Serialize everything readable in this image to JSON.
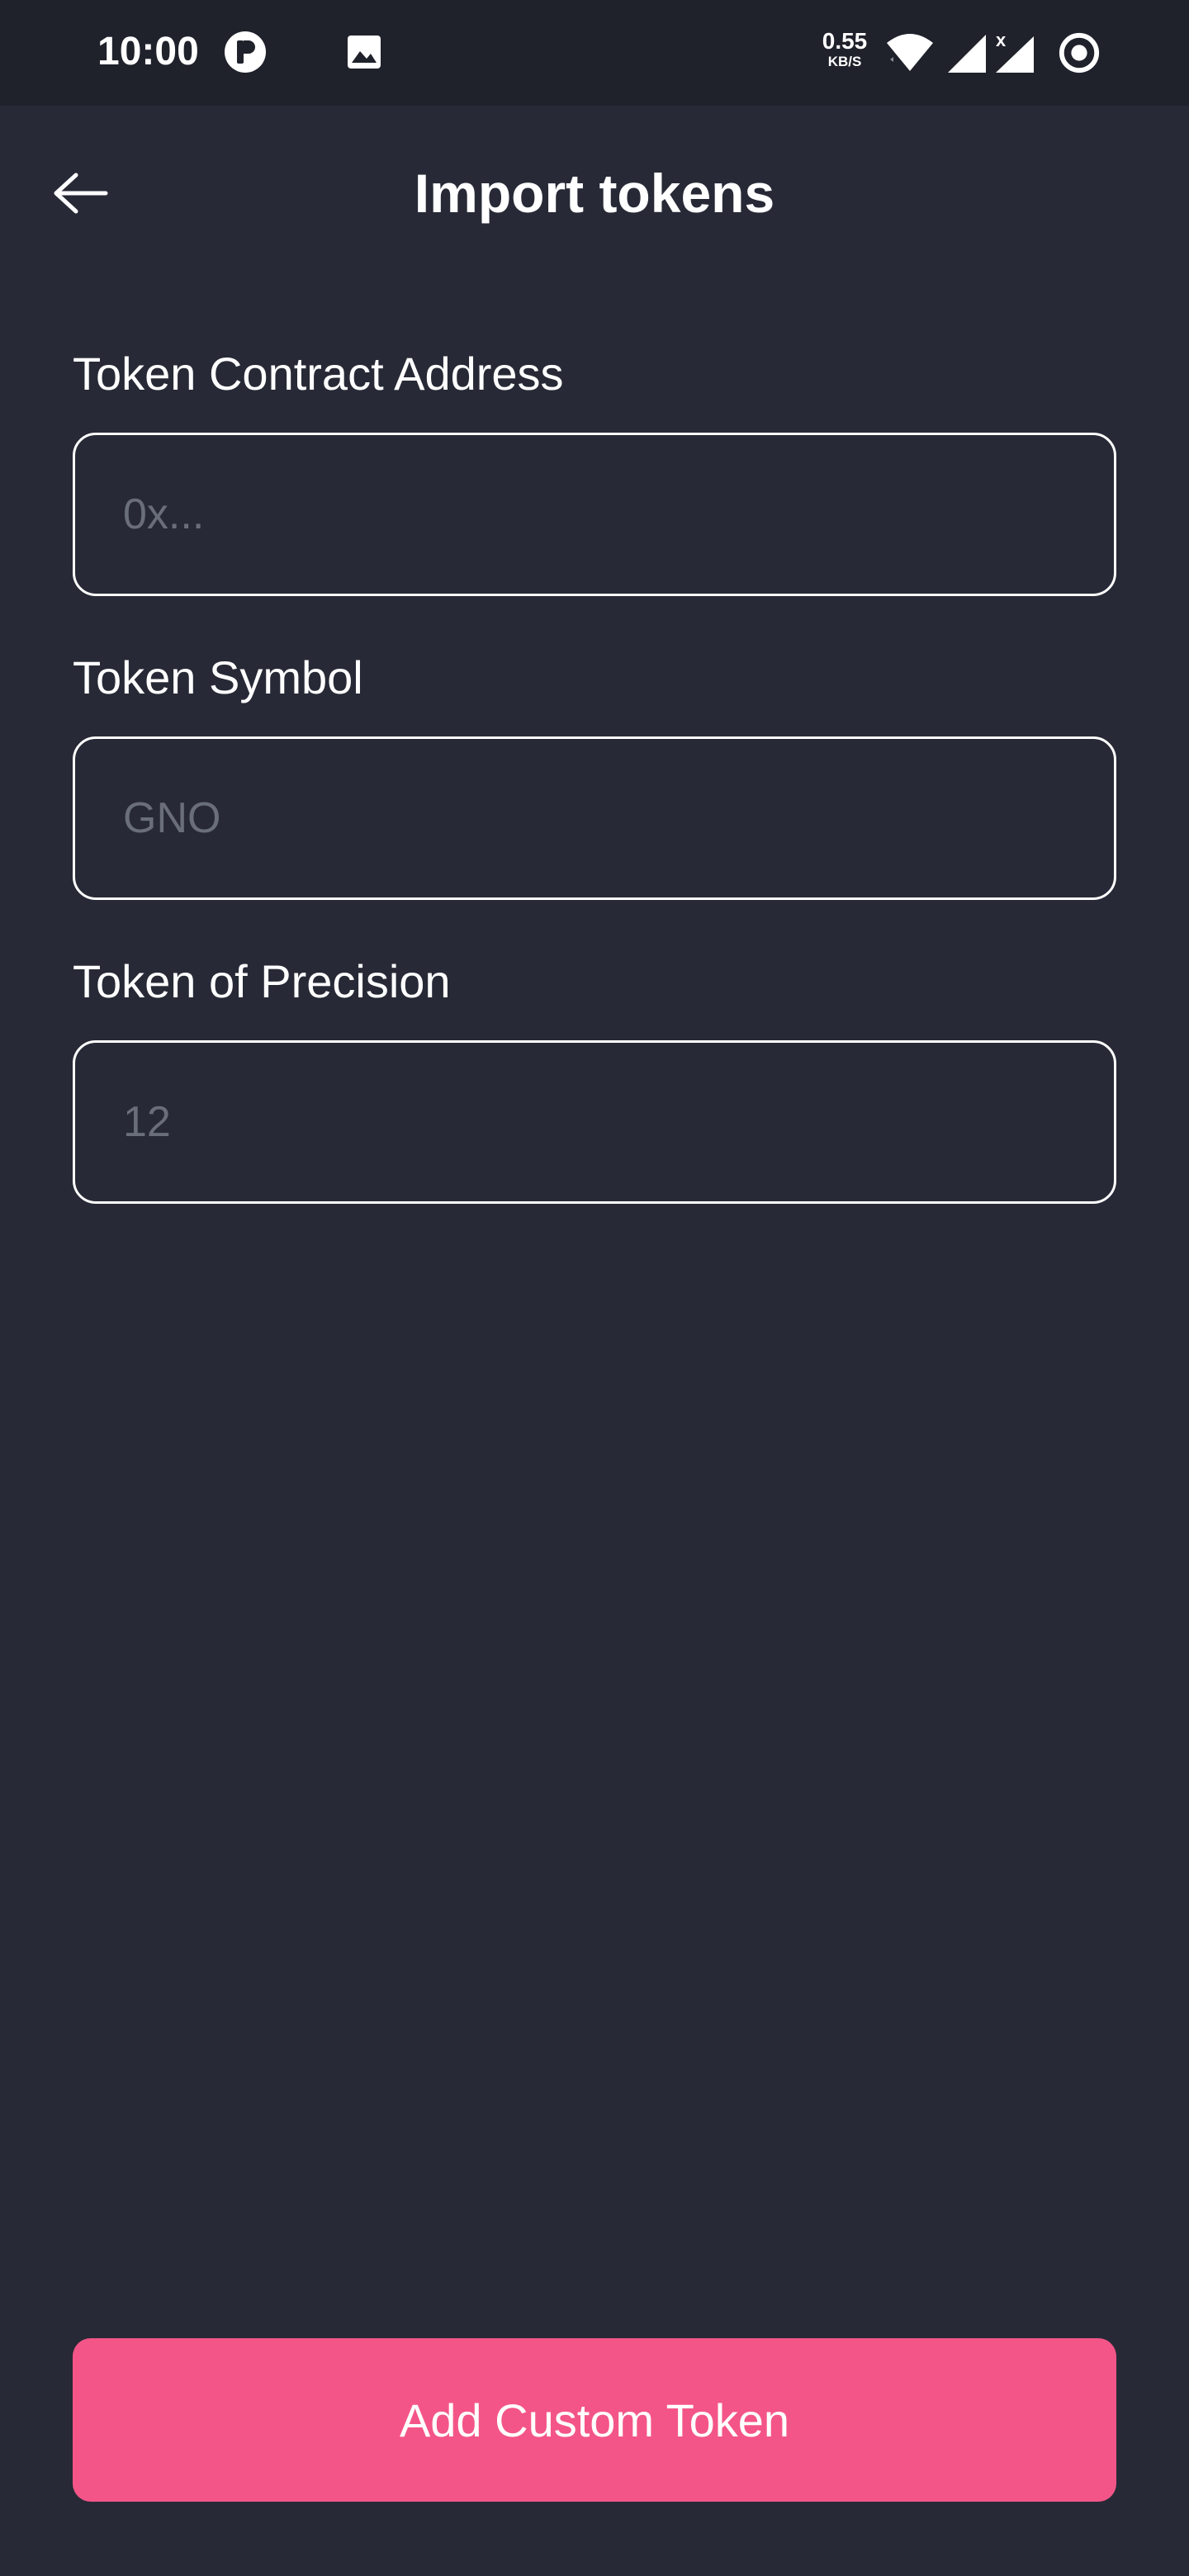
{
  "status_bar": {
    "time": "10:00",
    "network_speed_value": "0.55",
    "network_speed_unit": "KB/S",
    "icons": [
      "app-notification-icon",
      "image-notification-icon",
      "wifi-icon",
      "signal-icon",
      "signal-no-service-icon",
      "record-icon"
    ]
  },
  "header": {
    "title": "Import tokens",
    "back_icon": "arrow-left-icon"
  },
  "form": {
    "fields": [
      {
        "label": "Token Contract Address",
        "placeholder": "0x...",
        "value": ""
      },
      {
        "label": "Token Symbol",
        "placeholder": "GNO",
        "value": ""
      },
      {
        "label": "Token of Precision",
        "placeholder": "12",
        "value": ""
      }
    ]
  },
  "actions": {
    "add_label": "Add Custom Token"
  },
  "colors": {
    "background": "#272a36",
    "status_bar": "#1f212b",
    "accent": "#f45588",
    "placeholder": "#6a6e7b"
  }
}
